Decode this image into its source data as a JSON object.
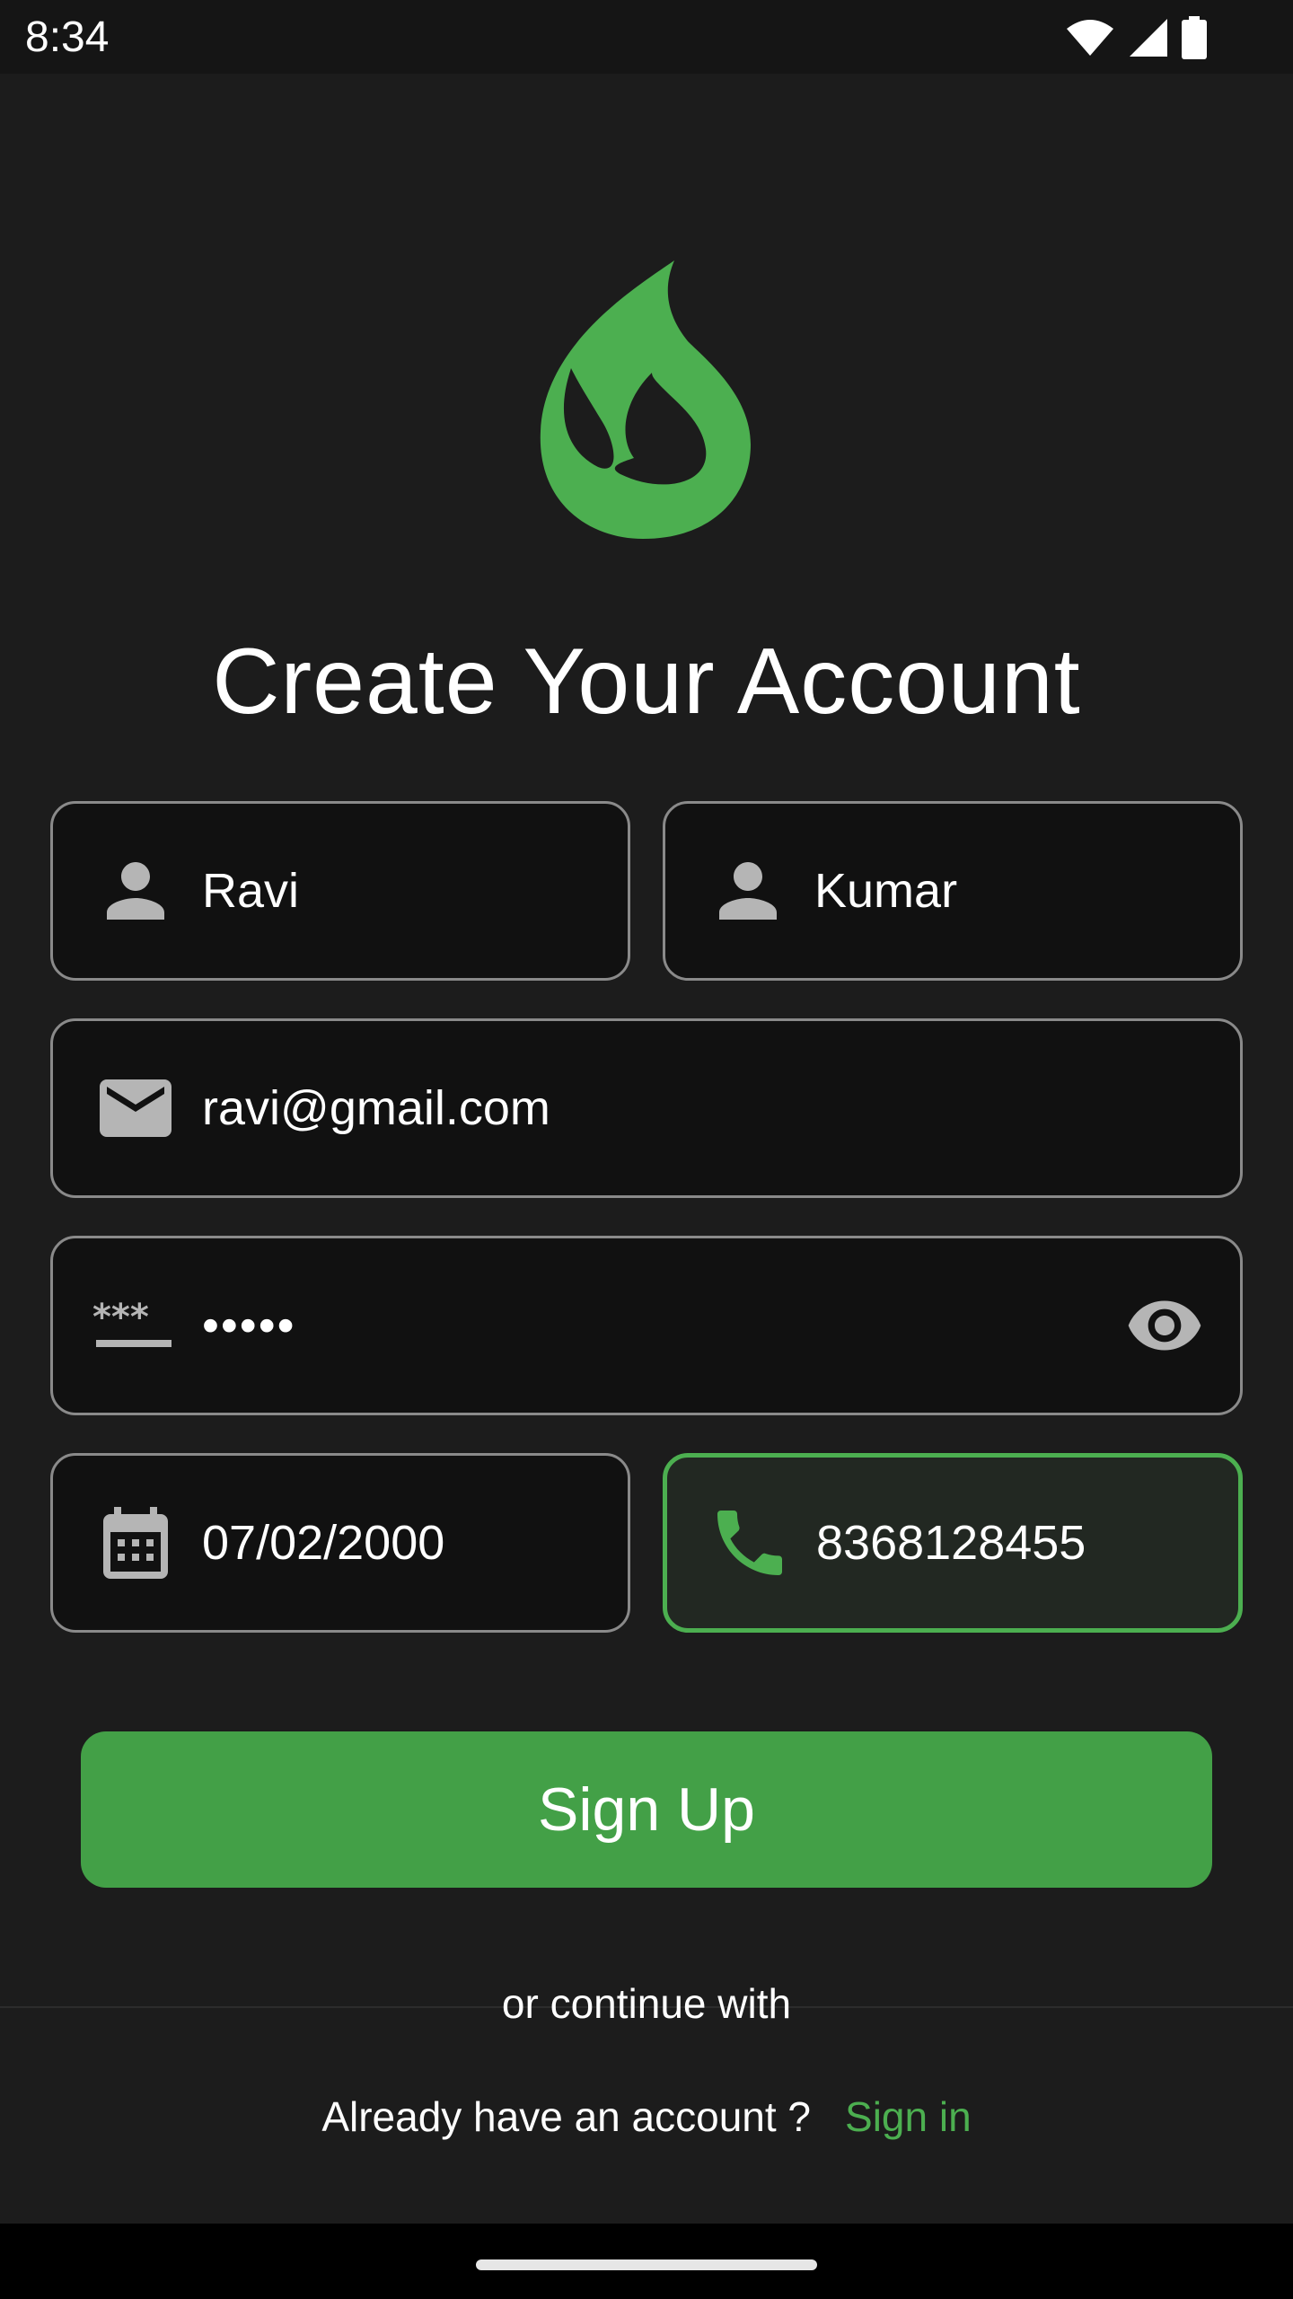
{
  "status_bar": {
    "time": "8:34"
  },
  "logo": {
    "name": "flame-logo",
    "color": "#4caf50"
  },
  "title": "Create Your Account",
  "form": {
    "first_name": {
      "value": "Ravi",
      "icon": "person-icon"
    },
    "last_name": {
      "value": "Kumar",
      "icon": "person-icon"
    },
    "email": {
      "value": "ravi@gmail.com",
      "icon": "mail-icon"
    },
    "password": {
      "value": "•••••",
      "icon": "password-icon",
      "toggle_icon": "eye-icon"
    },
    "dob": {
      "value": "07/02/2000",
      "icon": "calendar-icon"
    },
    "phone": {
      "value": "8368128455",
      "icon": "phone-icon",
      "focused": true
    }
  },
  "signup_label": "Sign Up",
  "continue_text": "or continue with",
  "signin": {
    "prompt": "Already have an account ?",
    "link": "Sign in"
  },
  "colors": {
    "accent": "#4caf50",
    "button": "#43a047",
    "background": "#1c1c1c",
    "field_bg": "#111111",
    "border": "#8a8a8a"
  }
}
